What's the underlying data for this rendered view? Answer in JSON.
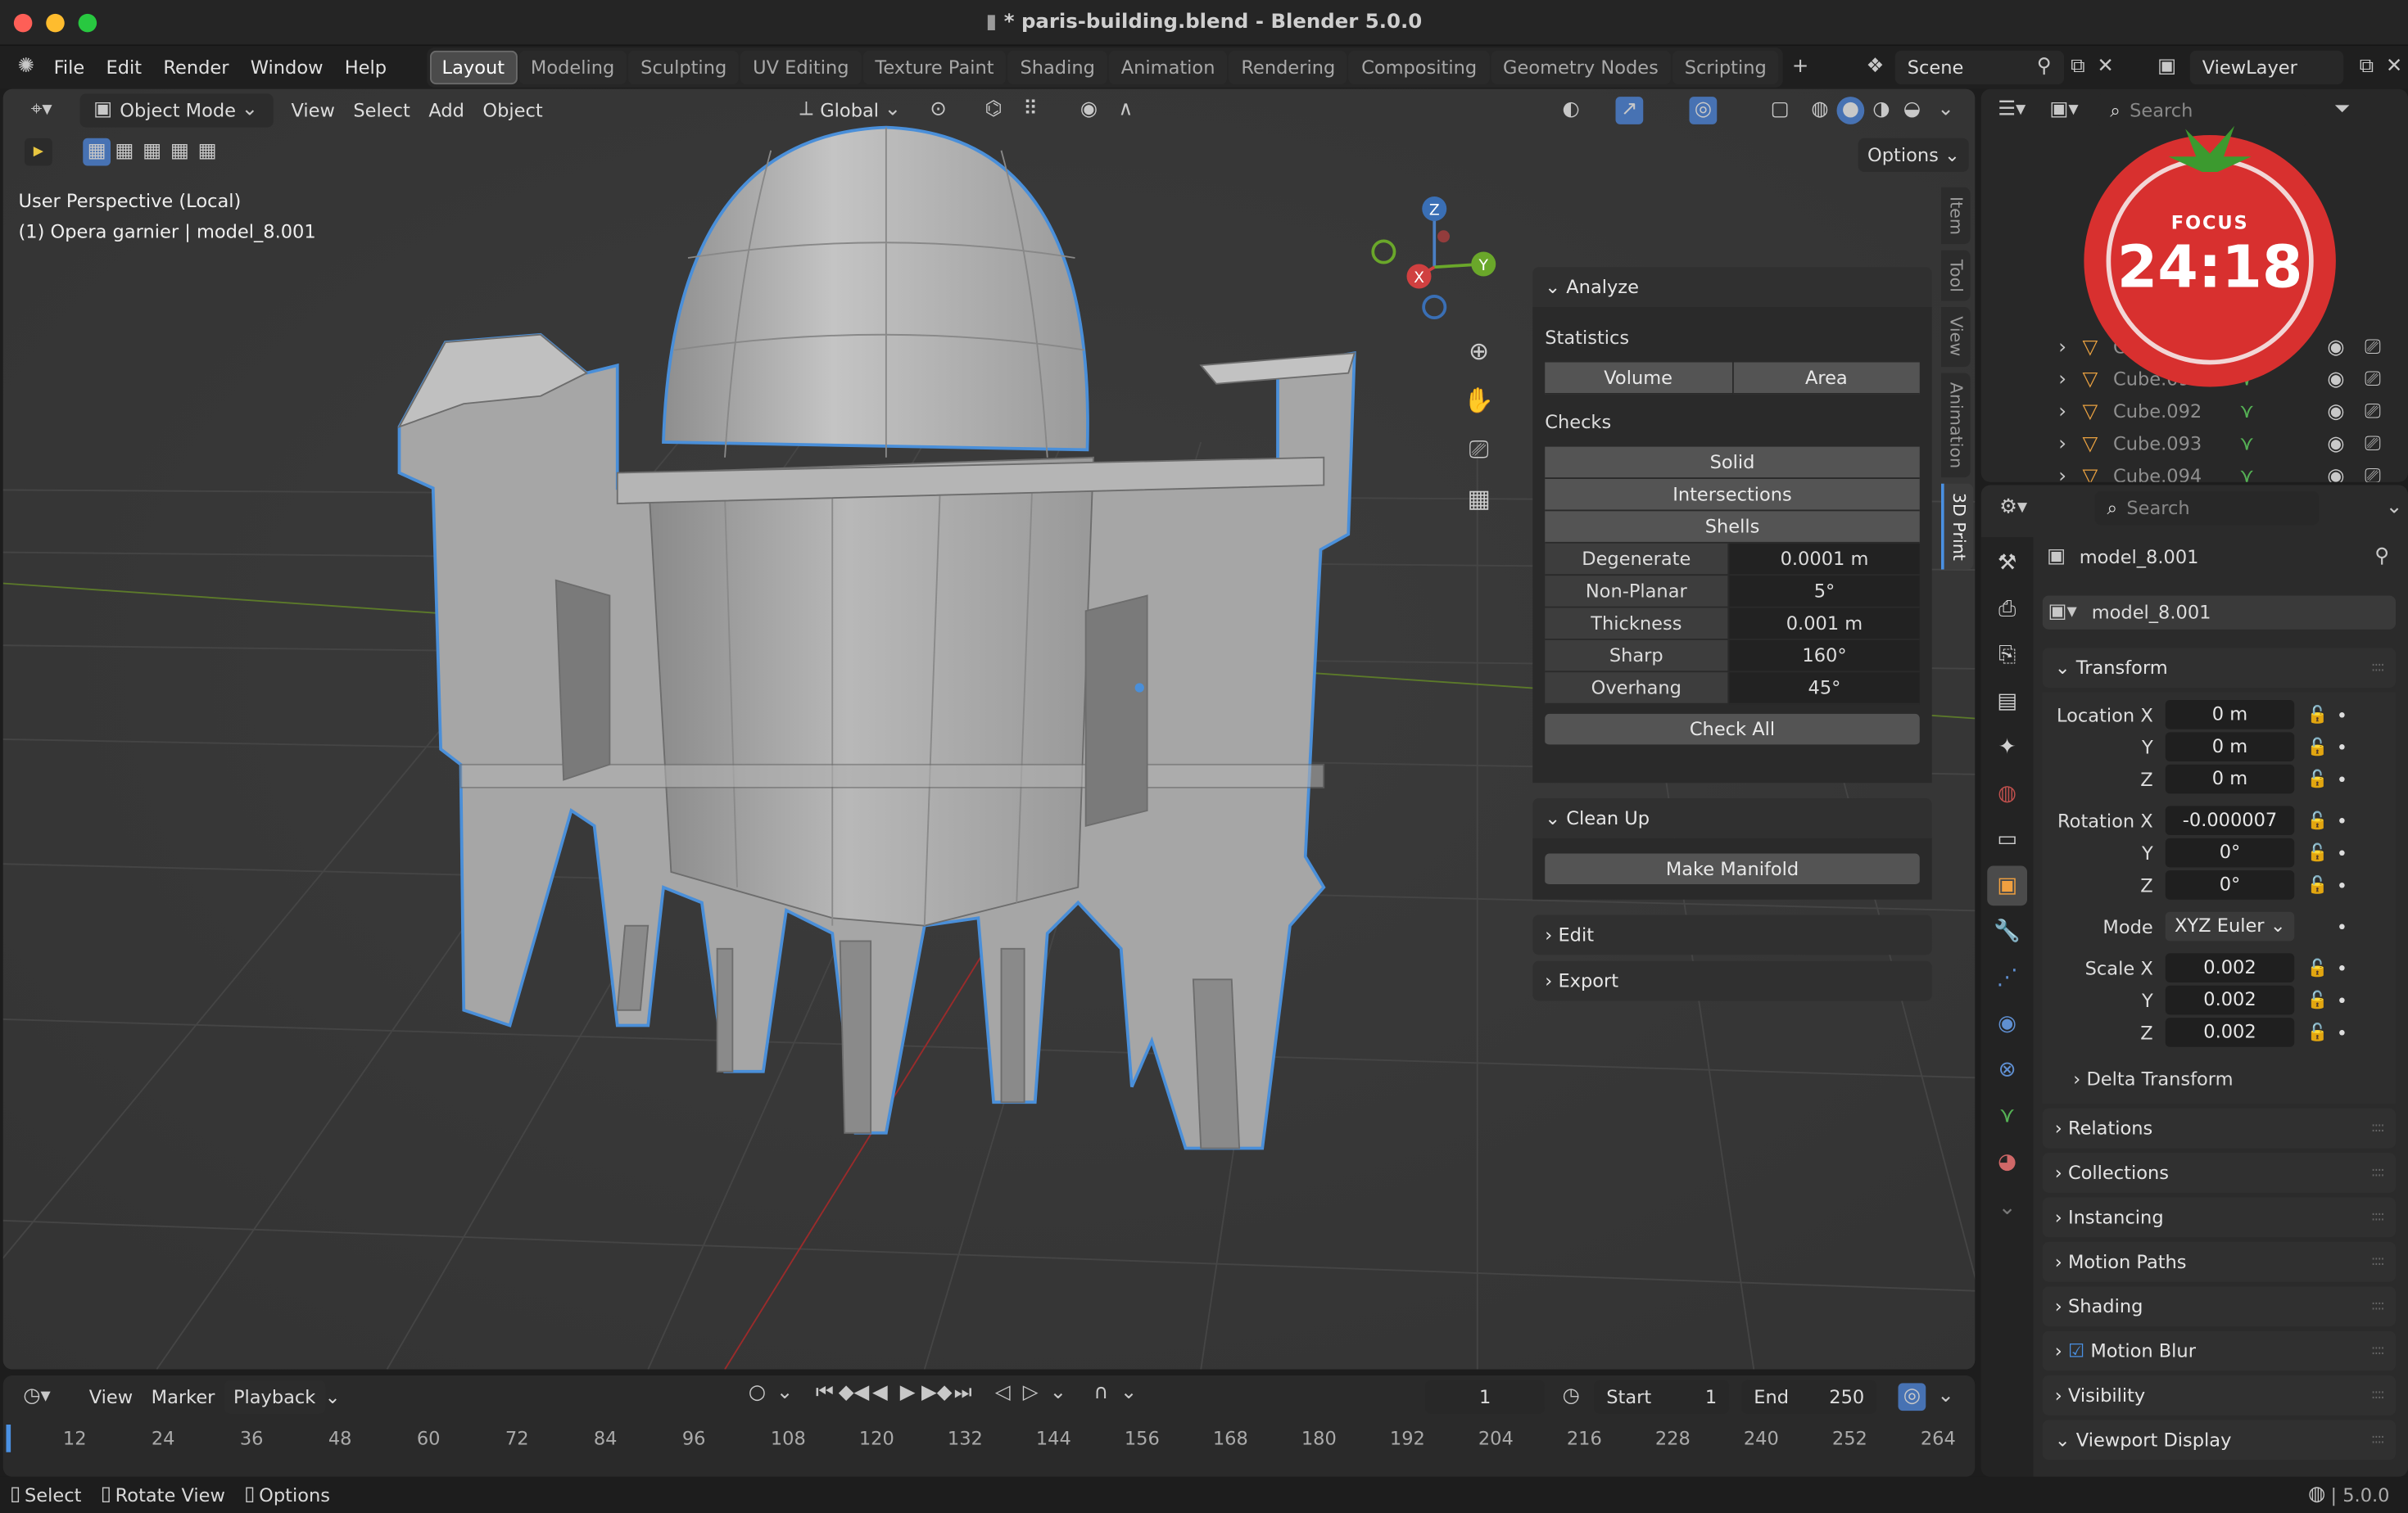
{
  "window": {
    "title": "* paris-building.blend - Blender 5.0.0"
  },
  "menu": [
    "File",
    "Edit",
    "Render",
    "Window",
    "Help"
  ],
  "workspaces": [
    "Layout",
    "Modeling",
    "Sculpting",
    "UV Editing",
    "Texture Paint",
    "Shading",
    "Animation",
    "Rendering",
    "Compositing",
    "Geometry Nodes",
    "Scripting"
  ],
  "active_workspace": "Layout",
  "scene": {
    "name": "Scene",
    "view_layer": "ViewLayer"
  },
  "viewport": {
    "mode": "Object Mode",
    "menus": [
      "View",
      "Select",
      "Add",
      "Object"
    ],
    "orientation": "Global",
    "options_label": "Options",
    "perspective_label": "User Perspective (Local)",
    "object_label": "(1) Opera garnier | model_8.001",
    "gizmo": {
      "z": "Z",
      "y": "Y",
      "x": "X"
    },
    "sidebar_tabs": [
      "Item",
      "Tool",
      "View",
      "Animation",
      "3D Print"
    ],
    "active_sidebar_tab": "3D Print"
  },
  "print3d": {
    "analyze_title": "Analyze",
    "statistics_label": "Statistics",
    "volume_label": "Volume",
    "area_label": "Area",
    "checks_label": "Checks",
    "check_buttons": [
      "Solid",
      "Intersections",
      "Shells"
    ],
    "params": [
      {
        "label": "Degenerate",
        "value": "0.0001 m"
      },
      {
        "label": "Non-Planar",
        "value": "5°"
      },
      {
        "label": "Thickness",
        "value": "0.001 m"
      },
      {
        "label": "Sharp",
        "value": "160°"
      },
      {
        "label": "Overhang",
        "value": "45°"
      }
    ],
    "check_all_label": "Check All",
    "cleanup_title": "Clean Up",
    "make_manifold_label": "Make Manifold",
    "edit_title": "Edit",
    "export_title": "Export"
  },
  "outliner": {
    "search_placeholder": "Search",
    "rows": [
      "Cube.090",
      "Cube.091",
      "Cube.092",
      "Cube.093",
      "Cube.094"
    ]
  },
  "focus_timer": {
    "label": "FOCUS",
    "time": "24:18",
    "color": "#d8302f"
  },
  "properties": {
    "search_placeholder": "Search",
    "object_name": "model_8.001",
    "data_name": "model_8.001",
    "transform_title": "Transform",
    "location": {
      "label": "Location X",
      "y_label": "Y",
      "z_label": "Z",
      "x": "0 m",
      "y": "0 m",
      "z": "0 m"
    },
    "rotation": {
      "label": "Rotation X",
      "y_label": "Y",
      "z_label": "Z",
      "x": "-0.000007",
      "y": "0°",
      "z": "0°"
    },
    "mode_label": "Mode",
    "mode_value": "XYZ Euler",
    "scale": {
      "label": "Scale X",
      "y_label": "Y",
      "z_label": "Z",
      "x": "0.002",
      "y": "0.002",
      "z": "0.002"
    },
    "sections": [
      "Delta Transform",
      "Relations",
      "Collections",
      "Instancing",
      "Motion Paths",
      "Shading",
      "Motion Blur",
      "Visibility",
      "Viewport Display"
    ]
  },
  "timeline": {
    "menus": [
      "View",
      "Marker",
      "Playback"
    ],
    "current_frame": "1",
    "start_label": "Start",
    "start_value": "1",
    "end_label": "End",
    "end_value": "250",
    "ruler": [
      "12",
      "24",
      "36",
      "48",
      "60",
      "72",
      "84",
      "96",
      "108",
      "120",
      "132",
      "144",
      "156",
      "168",
      "180",
      "192",
      "204",
      "216",
      "228",
      "240",
      "252",
      "264"
    ]
  },
  "statusbar": {
    "items": [
      "Select",
      "Rotate View",
      "Options"
    ],
    "version": "5.0.0"
  },
  "colors": {
    "accent": "#4a90e2",
    "selection_outline": "#4a8fd9",
    "bg": "#1d1d1d",
    "viewport": "#393939"
  }
}
